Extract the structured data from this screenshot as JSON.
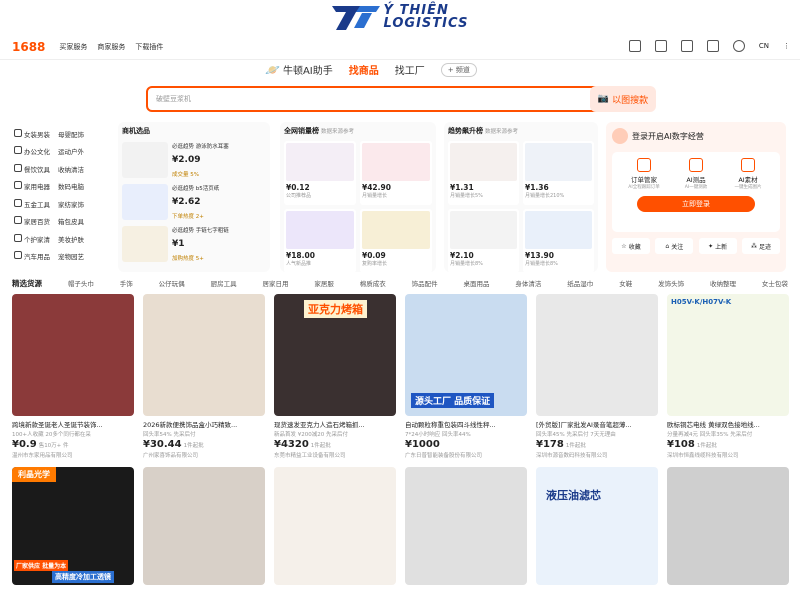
{
  "brand": {
    "line1": "Ý THIÊN",
    "line2": "LOGISTICS"
  },
  "topbar": {
    "logo": "1688",
    "nav": [
      "买家服务",
      "商家服务",
      "下载插件"
    ],
    "lang": "CN"
  },
  "search": {
    "ai_tab": "牛顿AI助手",
    "tabs": [
      "找商品",
      "找工厂"
    ],
    "more": "+ 频道",
    "placeholder": "破壁豆浆机",
    "button": "搜索",
    "image_search": "以图搜款"
  },
  "categories": [
    [
      "女装男装",
      "母婴配饰"
    ],
    [
      "办公文化",
      "运动户外"
    ],
    [
      "餐饮饮具",
      "收纳清洁"
    ],
    [
      "家用电器",
      "数码电脑"
    ],
    [
      "五金工具",
      "家纺家饰"
    ],
    [
      "家居百货",
      "箱包皮具"
    ],
    [
      "个护家清",
      "美妆护肤"
    ],
    [
      "汽车用品",
      "宠物园艺"
    ]
  ],
  "shop_panel": {
    "title": "商机选品",
    "items": [
      {
        "name": "必逛趋势 游泳防水耳塞",
        "price": "¥2.09",
        "tag": "成交量 5%"
      },
      {
        "name": "必逛趋势 b5活页纸",
        "price": "¥2.62",
        "tag": "下单热度 2+"
      },
      {
        "name": "必逛趋势 手链七字粗链",
        "price": "¥1",
        "tag": "加购热度 5+"
      }
    ]
  },
  "hot_panel": {
    "title": "全网销量榜",
    "sub": "数据来源参考",
    "items": [
      {
        "price": "¥0.12",
        "note": "公司推荐品"
      },
      {
        "price": "¥42.90",
        "note": "月销量增长"
      },
      {
        "price": "¥18.00",
        "note": "人气新品推"
      },
      {
        "price": "¥0.09",
        "note": "复购率增长"
      }
    ]
  },
  "trend_panel": {
    "title": "趋势飙升榜",
    "sub": "数据来源参考",
    "items": [
      {
        "price": "¥1.31",
        "note": "月销量增长5%"
      },
      {
        "price": "¥1.36",
        "note": "月销量增长210%"
      },
      {
        "price": "¥2.10",
        "note": "月销量增长8%"
      },
      {
        "price": "¥13.90",
        "note": "月销量增长8%"
      }
    ]
  },
  "login": {
    "title": "登录开启AI数字经营",
    "features": [
      {
        "label": "订单管家",
        "sub": "AI全程跟踪订单"
      },
      {
        "label": "AI测品",
        "sub": "AI一键测款"
      },
      {
        "label": "AI素材",
        "sub": "一键生成图片"
      }
    ],
    "button": "立即登录",
    "quick": [
      "收藏",
      "关注",
      "上新",
      "足迹"
    ]
  },
  "catbar": [
    "精选货源",
    "帽子头巾",
    "手饰",
    "公仔玩偶",
    "厨房工具",
    "居家日用",
    "家居服",
    "棉质成衣",
    "饰品配件",
    "桌面用品",
    "身体清洁",
    "纸品湿巾",
    "女鞋",
    "发饰头饰",
    "收纳整理",
    "女士包袋"
  ],
  "cards": [
    {
      "title": "跨境新款圣诞老人圣诞节装饰...",
      "meta": "100+人收藏 20多个同行都在采",
      "price": "¥0.9",
      "unit": "售10万+ 件",
      "seller": "温州市东家用品有限公司",
      "bg": "#8b3a3a",
      "ovl": ""
    },
    {
      "title": "2026新款便携饰品盒小巧精致...",
      "meta": "回头率54% 先采后付",
      "price": "¥30.44",
      "unit": "1件起批",
      "seller": "广州家喜饰品有限公司",
      "bg": "#e8ddd0",
      "ovl": ""
    },
    {
      "title": "现货速发亚克力人造石烤箱抓...",
      "meta": "新品首发 ¥200减20 先采后付",
      "price": "¥4320",
      "unit": "1件起批",
      "seller": "东莞市精益工业设备有限公司",
      "bg": "#3a3030",
      "ovl": "亚克力烤箱"
    },
    {
      "title": "自动颗粒称重包装四斗线性秤...",
      "meta": "7*24小时响应 回头率44%",
      "price": "¥1000",
      "unit": "",
      "seller": "广东日普智能装备股份有限公司",
      "bg": "#c9dcf0",
      "ovl": "源头工厂 品质保证"
    },
    {
      "title": "[外贸版]厂家批发AI录音笔超薄...",
      "meta": "回头率45% 先采后付 7天无理由",
      "price": "¥178",
      "unit": "1件起批",
      "seller": "深圳市源音数码科技有限公司",
      "bg": "#e8e8e8",
      "ovl": ""
    },
    {
      "title": "欧标铜芯电线 黄绿双色接地线...",
      "meta": "分量再减4元 回头率35% 先采后付",
      "price": "¥108",
      "unit": "1件起批",
      "seller": "深圳市恒鑫线缆科技有限公司",
      "bg": "#f3f7e8",
      "ovl": "H05V-K/H07V-K"
    },
    {
      "title": "",
      "meta": "",
      "price": "",
      "unit": "",
      "seller": "",
      "bg": "#1a1a1a",
      "ovl": "利晶光学"
    },
    {
      "title": "",
      "meta": "",
      "price": "",
      "unit": "",
      "seller": "",
      "bg": "#d8d0c8",
      "ovl": ""
    },
    {
      "title": "",
      "meta": "",
      "price": "",
      "unit": "",
      "seller": "",
      "bg": "#f5f0ea",
      "ovl": ""
    },
    {
      "title": "",
      "meta": "",
      "price": "",
      "unit": "",
      "seller": "",
      "bg": "#e0e0e0",
      "ovl": ""
    },
    {
      "title": "",
      "meta": "",
      "price": "",
      "unit": "",
      "seller": "",
      "bg": "#eaf2fb",
      "ovl": "液压油滤芯"
    },
    {
      "title": "",
      "meta": "",
      "price": "",
      "unit": "",
      "seller": "",
      "bg": "#cfcfcf",
      "ovl": ""
    }
  ],
  "bottom_banners": {
    "c7a": "厂家供应 批量为本",
    "c7b": "高精度冷加工透镜"
  },
  "colors": {
    "accent": "#ff5000",
    "brand_blue": "#1a3a8a"
  }
}
